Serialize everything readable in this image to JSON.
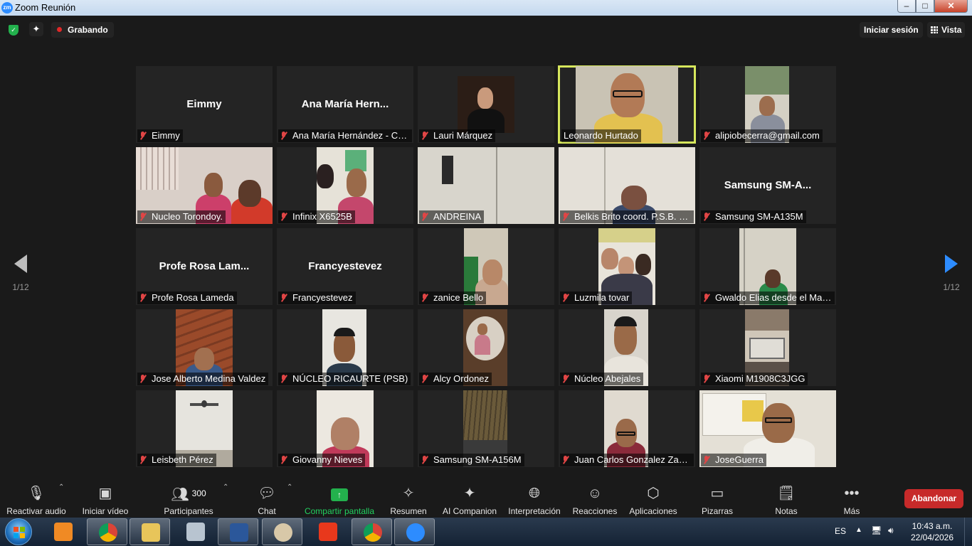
{
  "window": {
    "title": "Zoom Reunión",
    "app_icon": "zm"
  },
  "topbar": {
    "recording_label": "Grabando",
    "signin_label": "Iniciar sesión",
    "view_label": "Vista"
  },
  "pagination": {
    "left_label": "1/12",
    "right_label": "1/12"
  },
  "participants": [
    {
      "name": "Eimmy",
      "display": "Eimmy",
      "muted": true,
      "video": false
    },
    {
      "name": "Ana María Hernández - Co...",
      "display": "Ana María Hern...",
      "muted": true,
      "video": false
    },
    {
      "name": "Lauri Márquez",
      "muted": true,
      "video": true
    },
    {
      "name": "Leonardo Hurtado",
      "muted": false,
      "video": true,
      "active_speaker": true
    },
    {
      "name": "alipiobecerra@gmail.com",
      "muted": true,
      "video": true
    },
    {
      "name": "Nucleo Torondoy.",
      "muted": true,
      "video": true
    },
    {
      "name": "Infinix X6525B",
      "muted": true,
      "video": true
    },
    {
      "name": "ANDREINA",
      "muted": true,
      "video": true
    },
    {
      "name": "Belkis Brito coord. P.S.B. nu...",
      "muted": true,
      "video": true
    },
    {
      "name": "Samsung SM-A135M",
      "display": "Samsung SM-A...",
      "muted": true,
      "video": false
    },
    {
      "name": "Profe Rosa Lameda",
      "display": "Profe Rosa Lam...",
      "muted": true,
      "video": false
    },
    {
      "name": "Francyestevez",
      "display": "Francyestevez",
      "muted": true,
      "video": false
    },
    {
      "name": "zanice Bello",
      "muted": true,
      "video": true
    },
    {
      "name": "Luzmila tovar",
      "muted": true,
      "video": true
    },
    {
      "name": "Gwaldo Elias desde el Man...",
      "muted": true,
      "video": true
    },
    {
      "name": "Jose Alberto Medina Valdez",
      "muted": true,
      "video": true
    },
    {
      "name": "NÚCLEO RICAURTE (PSB)",
      "muted": true,
      "video": true
    },
    {
      "name": "Alcy Ordonez",
      "muted": true,
      "video": true
    },
    {
      "name": "Núcleo Abejales",
      "muted": true,
      "video": true
    },
    {
      "name": "Xiaomi M1908C3JGG",
      "muted": true,
      "video": true
    },
    {
      "name": "Leisbeth Pérez",
      "muted": true,
      "video": true
    },
    {
      "name": "Giovanny Nieves",
      "muted": true,
      "video": true
    },
    {
      "name": "Samsung SM-A156M",
      "muted": true,
      "video": true
    },
    {
      "name": "Juan Carlos Gonzalez Zapa...",
      "muted": true,
      "video": true
    },
    {
      "name": "JoseGuerra",
      "muted": true,
      "video": true
    }
  ],
  "toolbar": {
    "audio": "Reactivar audio",
    "video": "Iniciar vídeo",
    "participants": "Participantes",
    "participants_count": "300",
    "chat": "Chat",
    "share": "Compartir pantalla",
    "summary": "Resumen",
    "ai": "AI Companion",
    "interpretation": "Interpretación",
    "reactions": "Reacciones",
    "apps": "Aplicaciones",
    "whiteboards": "Pizarras",
    "notes": "Notas",
    "more": "Más",
    "leave": "Abandonar"
  },
  "taskbar": {
    "language": "ES",
    "time": "10:43 a.m.",
    "date": "22/04/2026",
    "apps": [
      "media-player",
      "chrome",
      "file-explorer",
      "calculator",
      "word",
      "paint",
      "acrobat",
      "chrome",
      "zoom"
    ]
  },
  "colors": {
    "active_speaker_border": "#d6e65c",
    "share_green": "#23d160",
    "leave_red": "#c72a2a",
    "muted_mic": "#e04545",
    "next_page_arrow": "#2d8cff"
  }
}
